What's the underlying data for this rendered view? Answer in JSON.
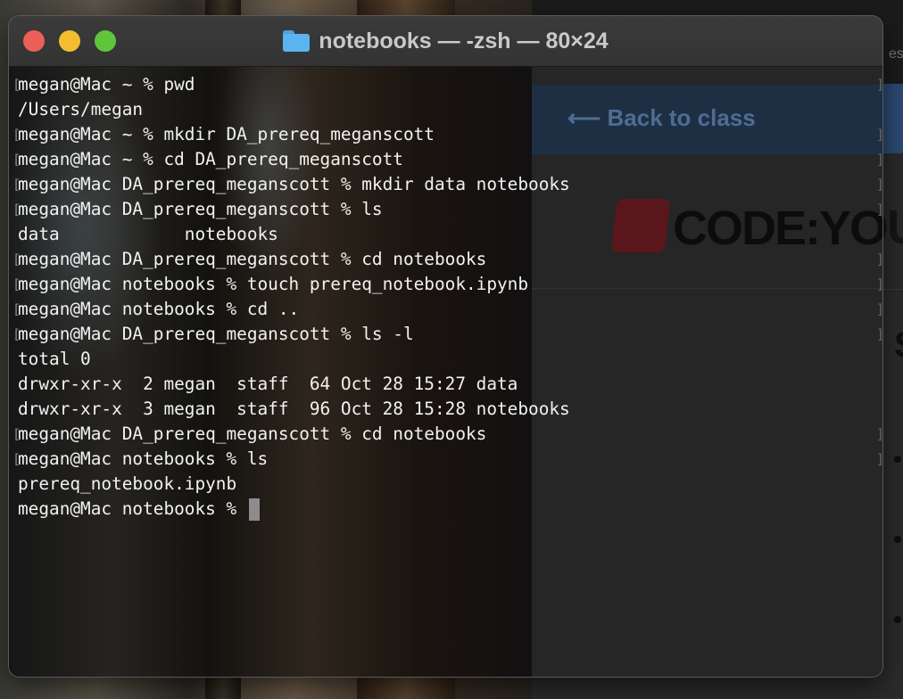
{
  "background_window": {
    "back_link": "⟵ Back to class",
    "logo_text": "CODE:YOU",
    "heading_initial": "S",
    "corner_text": "es"
  },
  "terminal": {
    "title": "notebooks — -zsh — 80×24",
    "icon": "folder-icon",
    "lines": [
      {
        "text": "megan@Mac ~ % pwd",
        "marked": true
      },
      {
        "text": "/Users/megan",
        "marked": false
      },
      {
        "text": "megan@Mac ~ % mkdir DA_prereq_meganscott",
        "marked": true
      },
      {
        "text": "megan@Mac ~ % cd DA_prereq_meganscott",
        "marked": true
      },
      {
        "text": "megan@Mac DA_prereq_meganscott % mkdir data notebooks",
        "marked": true
      },
      {
        "text": "megan@Mac DA_prereq_meganscott % ls",
        "marked": true
      },
      {
        "text": "data            notebooks",
        "marked": false
      },
      {
        "text": "megan@Mac DA_prereq_meganscott % cd notebooks",
        "marked": true
      },
      {
        "text": "megan@Mac notebooks % touch prereq_notebook.ipynb",
        "marked": true
      },
      {
        "text": "megan@Mac notebooks % cd ..",
        "marked": true
      },
      {
        "text": "megan@Mac DA_prereq_meganscott % ls -l",
        "marked": true
      },
      {
        "text": "total 0",
        "marked": false
      },
      {
        "text": "drwxr-xr-x  2 megan  staff  64 Oct 28 15:27 data",
        "marked": false
      },
      {
        "text": "drwxr-xr-x  3 megan  staff  96 Oct 28 15:28 notebooks",
        "marked": false
      },
      {
        "text": "megan@Mac DA_prereq_meganscott % cd notebooks",
        "marked": true
      },
      {
        "text": "megan@Mac notebooks % ls",
        "marked": true
      },
      {
        "text": "prereq_notebook.ipynb",
        "marked": false
      },
      {
        "text": "megan@Mac notebooks % ",
        "marked": false,
        "cursor": true
      }
    ]
  },
  "colors": {
    "close": "#ec5f57",
    "minimize": "#f4bd30",
    "maximize": "#5fc63c",
    "terminal_text": "#f2f2f2"
  }
}
